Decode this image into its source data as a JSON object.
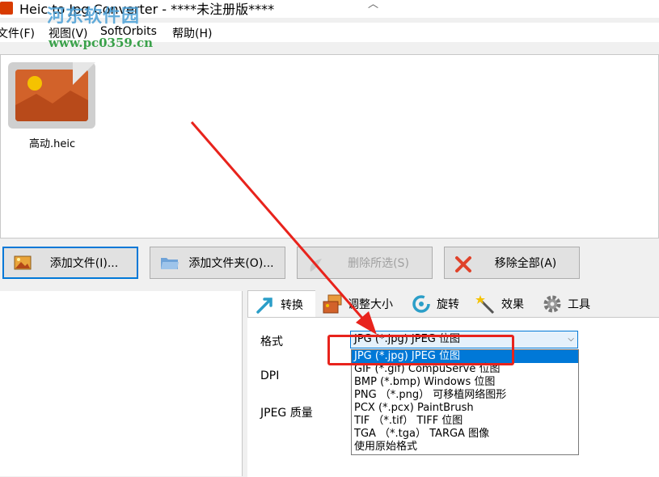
{
  "window": {
    "title": "Heic to Jpg Converter - ****未注册版****",
    "title_chevron": "︿"
  },
  "watermark": {
    "logo": "河东软件园",
    "url": "www.pc0359.cn"
  },
  "menu": {
    "items": [
      "文件(F)",
      "视图(V)",
      "SoftOrbits",
      "帮助(H)"
    ]
  },
  "files": [
    {
      "name": "高动.heic",
      "icon": "image-file-icon"
    }
  ],
  "toolbar": {
    "add_file": "添加文件(I)...",
    "add_folder": "添加文件夹(O)...",
    "remove_selected": "删除所选(S)",
    "remove_all": "移除全部(A)"
  },
  "tabs": [
    {
      "label": "转换",
      "icon": "convert-icon"
    },
    {
      "label": "调整大小",
      "icon": "resize-icon"
    },
    {
      "label": "旋转",
      "icon": "rotate-icon"
    },
    {
      "label": "效果",
      "icon": "magic-wand-icon"
    },
    {
      "label": "工具",
      "icon": "gear-icon"
    }
  ],
  "convert": {
    "format_label": "格式",
    "dpi_label": "DPI",
    "quality_label": "JPEG 质量",
    "format_selected": "JPG (*.jpg) JPEG 位图",
    "format_options": [
      "JPG (*.jpg) JPEG 位图",
      "GIF (*.gif) CompuServe 位图",
      "BMP (*.bmp) Windows 位图",
      "PNG （*.png） 可移植网络图形",
      "PCX (*.pcx) PaintBrush",
      "TIF （*.tif） TIFF 位图",
      "TGA （*.tga） TARGA 图像",
      "使用原始格式"
    ],
    "selected_index": 0
  },
  "colors": {
    "accent": "#0078d7",
    "annotation": "#e8231c"
  }
}
